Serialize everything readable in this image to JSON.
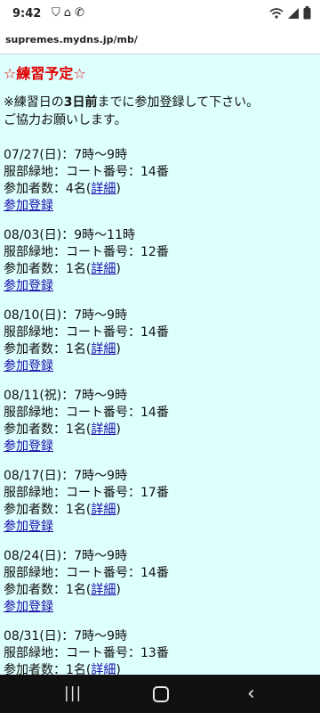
{
  "status_bar": {
    "time": "9:42",
    "left_icons": [
      "shield-icon",
      "home-icon",
      "phone-icon"
    ],
    "right_icons": [
      "wifi-icon",
      "signal-icon",
      "battery-icon"
    ]
  },
  "browser": {
    "url": "supremes.mydns.jp/mb/"
  },
  "page": {
    "title": "☆練習予定☆",
    "notice_prefix": "※練習日の",
    "notice_bold": "3日前",
    "notice_suffix": "までに参加登録して下さい。",
    "notice_line2": "ご協力お願いします。"
  },
  "events": [
    {
      "date_time": "07/27(日)：7時～9時",
      "location": "服部緑地：コート番号：14番",
      "participants_label": "参加者数：4名(",
      "detail_link": "詳細",
      "participants_close": ")",
      "register_link": "参加登録"
    },
    {
      "date_time": "08/03(日)：9時～11時",
      "location": "服部緑地：コート番号：12番",
      "participants_label": "参加者数：1名(",
      "detail_link": "詳細",
      "participants_close": ")",
      "register_link": "参加登録"
    },
    {
      "date_time": "08/10(日)：7時～9時",
      "location": "服部緑地：コート番号：14番",
      "participants_label": "参加者数：1名(",
      "detail_link": "詳細",
      "participants_close": ")",
      "register_link": "参加登録"
    },
    {
      "date_time": "08/11(祝)：7時～9時",
      "location": "服部緑地：コート番号：14番",
      "participants_label": "参加者数：1名(",
      "detail_link": "詳細",
      "participants_close": ")",
      "register_link": "参加登録"
    },
    {
      "date_time": "08/17(日)：7時～9時",
      "location": "服部緑地：コート番号：17番",
      "participants_label": "参加者数：1名(",
      "detail_link": "詳細",
      "participants_close": ")",
      "register_link": "参加登録"
    },
    {
      "date_time": "08/24(日)：7時～9時",
      "location": "服部緑地：コート番号：14番",
      "participants_label": "参加者数：1名(",
      "detail_link": "詳細",
      "participants_close": ")",
      "register_link": "参加登録"
    },
    {
      "date_time": "08/31(日)：7時～9時",
      "location": "服部緑地：コート番号：13番",
      "participants_label": "参加者数：1名(",
      "detail_link": "詳細",
      "participants_close": ")",
      "register_link": ""
    }
  ],
  "nav": {
    "recent_icon": "recent-apps-icon",
    "home_icon": "home-button-icon",
    "back_icon": "back-icon"
  }
}
